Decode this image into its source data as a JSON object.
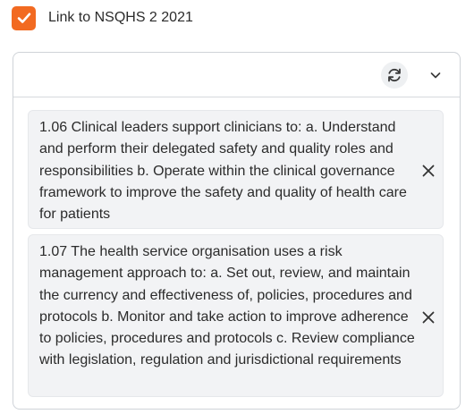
{
  "checkbox": {
    "label": "Link to NSQHS 2 2021",
    "checked": true,
    "color": "#f26a21",
    "icon": "checkmark-icon"
  },
  "panel": {
    "header": {
      "refresh_icon": "refresh-icon",
      "dropdown_icon": "chevron-down-icon"
    },
    "items": [
      {
        "text": "1.06 Clinical leaders support clinicians to: a. Understand and perform their delegated safety and quality roles and responsibilities b. Operate within the clinical governance framework to improve the safety and quality of health care for patients",
        "remove_icon": "close-icon"
      },
      {
        "text": "1.07 The health service organisation uses a risk management approach to: a. Set out, review, and maintain the currency and effectiveness of, policies, procedures and protocols b. Monitor and take action to improve adherence to policies, procedures and protocols c. Review compliance with legislation, regulation and jurisdictional requirements",
        "remove_icon": "close-icon"
      }
    ]
  }
}
